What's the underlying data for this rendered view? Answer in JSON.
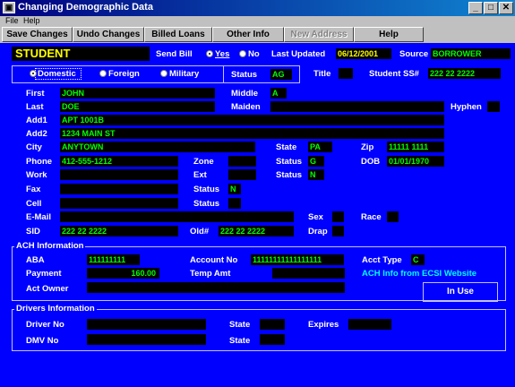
{
  "window": {
    "title": "Changing Demographic Data",
    "min": "_",
    "max": "□",
    "close": "✕"
  },
  "menu": {
    "file": "File",
    "help": "Help"
  },
  "toolbar": {
    "save": "Save Changes",
    "undo": "Undo Changes",
    "billed": "Billed Loans",
    "other": "Other Info",
    "new_address": "New Address",
    "help": "Help"
  },
  "header": {
    "student": "STUDENT",
    "send_bill_label": "Send Bill",
    "yes": "Yes",
    "no": "No",
    "last_updated_label": "Last Updated",
    "last_updated": "06/12/2001",
    "source_label": "Source",
    "source": "BORROWER"
  },
  "address_type": {
    "domestic": "Domestic",
    "foreign": "Foreign",
    "military": "Military",
    "status_label": "Status",
    "status": "AG"
  },
  "title_label": "Title",
  "ssn_label": "Student SS#",
  "ssn": "222 22 2222",
  "labels": {
    "first": "First",
    "middle": "Middle",
    "last": "Last",
    "maiden": "Maiden",
    "hyphen": "Hyphen",
    "add1": "Add1",
    "add2": "Add2",
    "city": "City",
    "state": "State",
    "zip": "Zip",
    "phone": "Phone",
    "zone": "Zone",
    "status": "Status",
    "dob": "DOB",
    "work": "Work",
    "ext": "Ext",
    "fax": "Fax",
    "cell": "Cell",
    "email": "E-Mail",
    "sex": "Sex",
    "race": "Race",
    "sid": "SID",
    "old": "Old#",
    "drap": "Drap"
  },
  "values": {
    "first": "JOHN",
    "middle": "A",
    "last": "DOE",
    "add1": "APT 1001B",
    "add2": "1234 MAIN ST",
    "city": "ANYTOWN",
    "state": "PA",
    "zip": "11111 1111",
    "phone": "412-555-1212",
    "phone_status": "G",
    "dob": "01/01/1970",
    "work_status": "N",
    "fax_status": "N",
    "sid": "222 22 2222",
    "old": "222 22 2222"
  },
  "ach": {
    "title": "ACH Information",
    "aba_label": "ABA",
    "aba": "111111111",
    "account_label": "Account No",
    "account": "11111111111111111",
    "acct_type_label": "Acct Type",
    "acct_type": "C",
    "payment_label": "Payment",
    "payment": "160.00",
    "temp_label": "Temp Amt",
    "link": "ACH Info from ECSI Website",
    "owner_label": "Act Owner",
    "in_use": "In Use"
  },
  "drivers": {
    "title": "Drivers Information",
    "driver_label": "Driver No",
    "state_label": "State",
    "expires_label": "Expires",
    "dmv_label": "DMV No",
    "state2_label": "State"
  }
}
